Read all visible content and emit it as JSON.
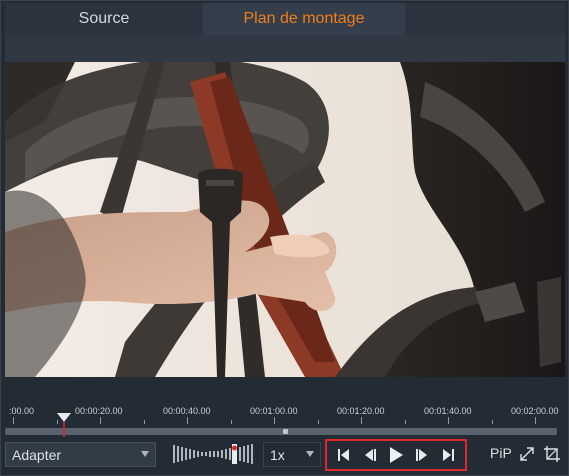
{
  "tabs": [
    {
      "label": "Source",
      "active": false
    },
    {
      "label": "Plan de montage",
      "active": true
    }
  ],
  "colors": {
    "active_tab": "#f07d1a",
    "transport_highlight": "#e0282c",
    "playhead_marker": "#e0282c"
  },
  "timeline": {
    "labels": [
      ":00.00",
      "00:00:20.00",
      "00:00:40.00",
      "00:01:00.00",
      "00:01:20.00",
      "00:01:40.00",
      "00:02:00.00"
    ]
  },
  "controls": {
    "fit_select": {
      "value": "Adapter"
    },
    "speed_select": {
      "value": "1x"
    },
    "transport": {
      "first": "skip-to-start-icon",
      "prev_frame": "step-back-icon",
      "play": "play-icon",
      "next_frame": "step-forward-icon",
      "last": "skip-to-end-icon"
    },
    "pip_label": "PiP",
    "fullscreen_icon": "fullscreen-icon",
    "crop_icon": "crop-icon"
  }
}
